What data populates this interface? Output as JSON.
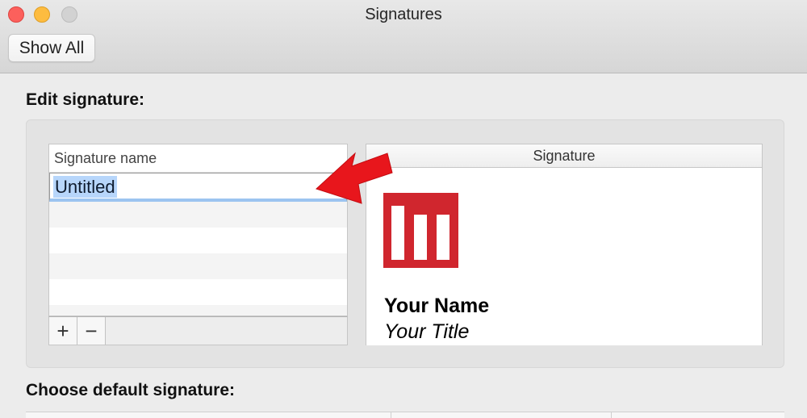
{
  "window": {
    "title": "Signatures"
  },
  "toolbar": {
    "show_all_label": "Show All"
  },
  "edit_section": {
    "heading": "Edit signature:",
    "name_list": {
      "header": "Signature name",
      "items": [
        "Untitled"
      ],
      "selected_index": 0
    },
    "add_label": "+",
    "remove_label": "−"
  },
  "signature": {
    "header": "Signature",
    "name": "Your Name",
    "title": "Your Title",
    "logo_icon": "brand-m-logo-icon",
    "logo_color": "#d0262e"
  },
  "choose_section": {
    "heading": "Choose default signature:"
  },
  "colors": {
    "arrow": "#e8161c",
    "selection": "#b7d6fb",
    "close": "#fc605c",
    "minimize": "#fdbc40",
    "zoom": "#d2d2d2"
  }
}
